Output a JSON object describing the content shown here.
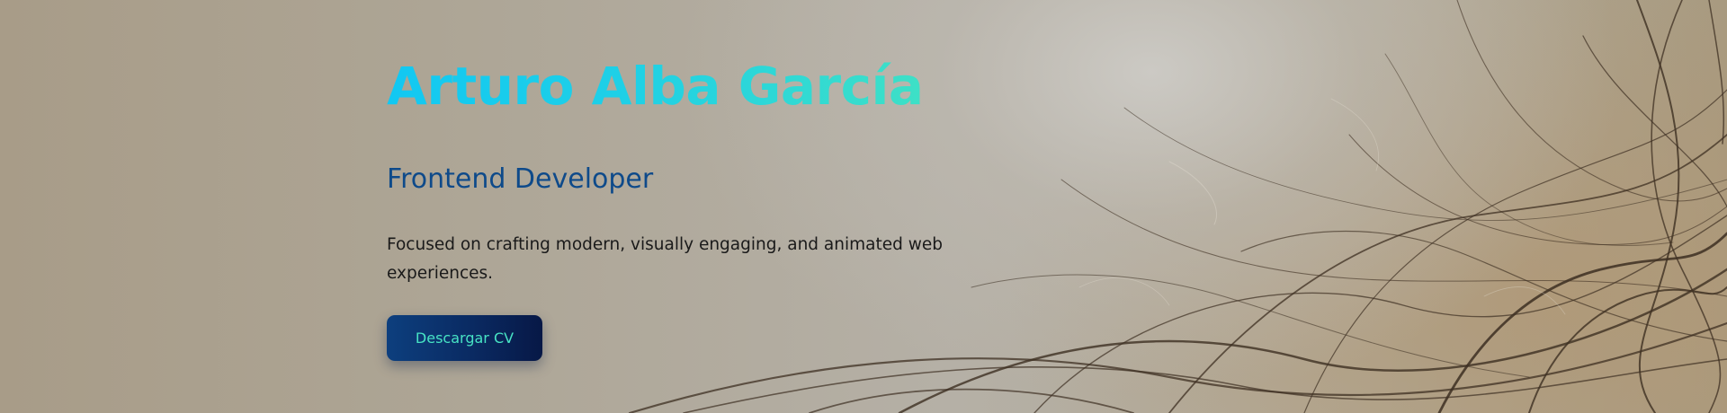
{
  "hero": {
    "name": "Arturo Alba García",
    "role": "Frontend Developer",
    "description": "Focused on crafting modern, visually engaging, and animated web experiences.",
    "cta_label": "Descargar CV"
  },
  "colors": {
    "name_gradient_start": "#12c8f2",
    "name_gradient_end": "#3ee0c6",
    "role": "#0e4a8a",
    "button_bg_start": "#0d3f7e",
    "button_bg_end": "#071846",
    "button_text": "#47e3c4"
  }
}
